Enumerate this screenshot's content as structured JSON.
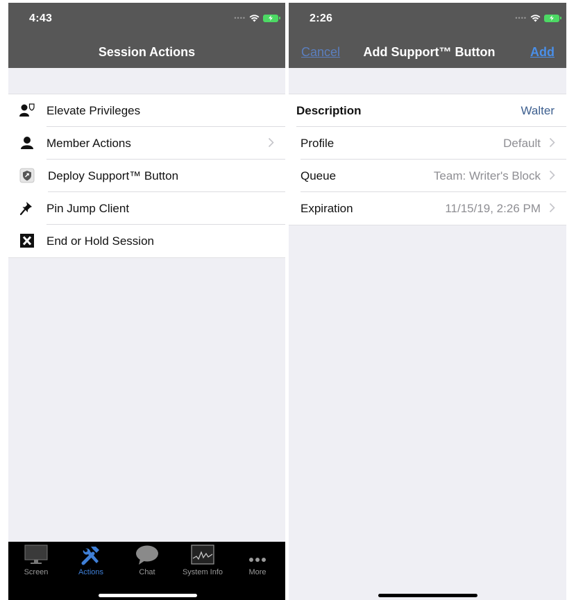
{
  "left_screen": {
    "status_time": "4:43",
    "title": "Session Actions",
    "menu_items": [
      {
        "label": "Elevate Privileges",
        "icon": "elevate-privileges-icon",
        "has_chevron": false
      },
      {
        "label": "Member Actions",
        "icon": "member-icon",
        "has_chevron": true
      },
      {
        "label": "Deploy Support™ Button",
        "icon": "support-button-icon",
        "has_chevron": false
      },
      {
        "label": "Pin Jump Client",
        "icon": "pin-icon",
        "has_chevron": false
      },
      {
        "label": "End or Hold Session",
        "icon": "end-session-icon",
        "has_chevron": false
      }
    ],
    "tabs": [
      {
        "label": "Screen",
        "icon": "monitor-icon",
        "active": false
      },
      {
        "label": "Actions",
        "icon": "tools-icon",
        "active": true
      },
      {
        "label": "Chat",
        "icon": "chat-bubble-icon",
        "active": false
      },
      {
        "label": "System Info",
        "icon": "system-graph-icon",
        "active": false
      },
      {
        "label": "More",
        "icon": "more-dots-icon",
        "active": false
      }
    ]
  },
  "right_screen": {
    "status_time": "2:26",
    "title": "Add Support™ Button",
    "cancel_label": "Cancel",
    "add_label": "Add",
    "fields": [
      {
        "label": "Description",
        "value": "Walter",
        "has_chevron": false
      },
      {
        "label": "Profile",
        "value": "Default",
        "has_chevron": true
      },
      {
        "label": "Queue",
        "value": "Team: Writer's Block",
        "has_chevron": true
      },
      {
        "label": "Expiration",
        "value": "11/15/19, 2:26 PM",
        "has_chevron": true
      }
    ]
  },
  "colors": {
    "header_bg": "#575757",
    "accent_blue": "#3f7fd6",
    "value_gray": "#8e8e93",
    "group_bg": "#efeff4"
  }
}
